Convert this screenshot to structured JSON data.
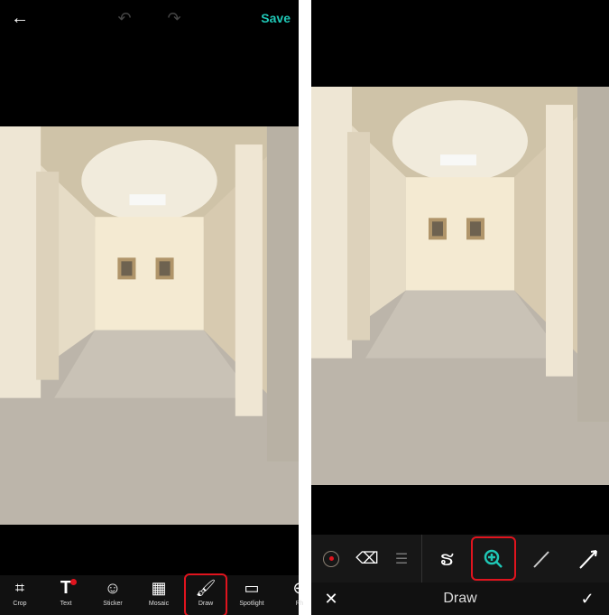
{
  "left": {
    "save_label": "Save",
    "tools": [
      {
        "label": "Crop",
        "icon": "crop-icon"
      },
      {
        "label": "Text",
        "icon": "text-icon"
      },
      {
        "label": "Sticker",
        "icon": "sticker-icon"
      },
      {
        "label": "Mosaic",
        "icon": "mosaic-icon"
      },
      {
        "label": "Draw",
        "icon": "brush-icon",
        "selected": true
      },
      {
        "label": "Spotlight",
        "icon": "spotlight-icon"
      },
      {
        "label": "Ph",
        "icon": "photo-add-icon"
      }
    ]
  },
  "right": {
    "title": "Draw"
  },
  "colors": {
    "accent": "#1fc7b6",
    "highlight": "#e0141e"
  }
}
